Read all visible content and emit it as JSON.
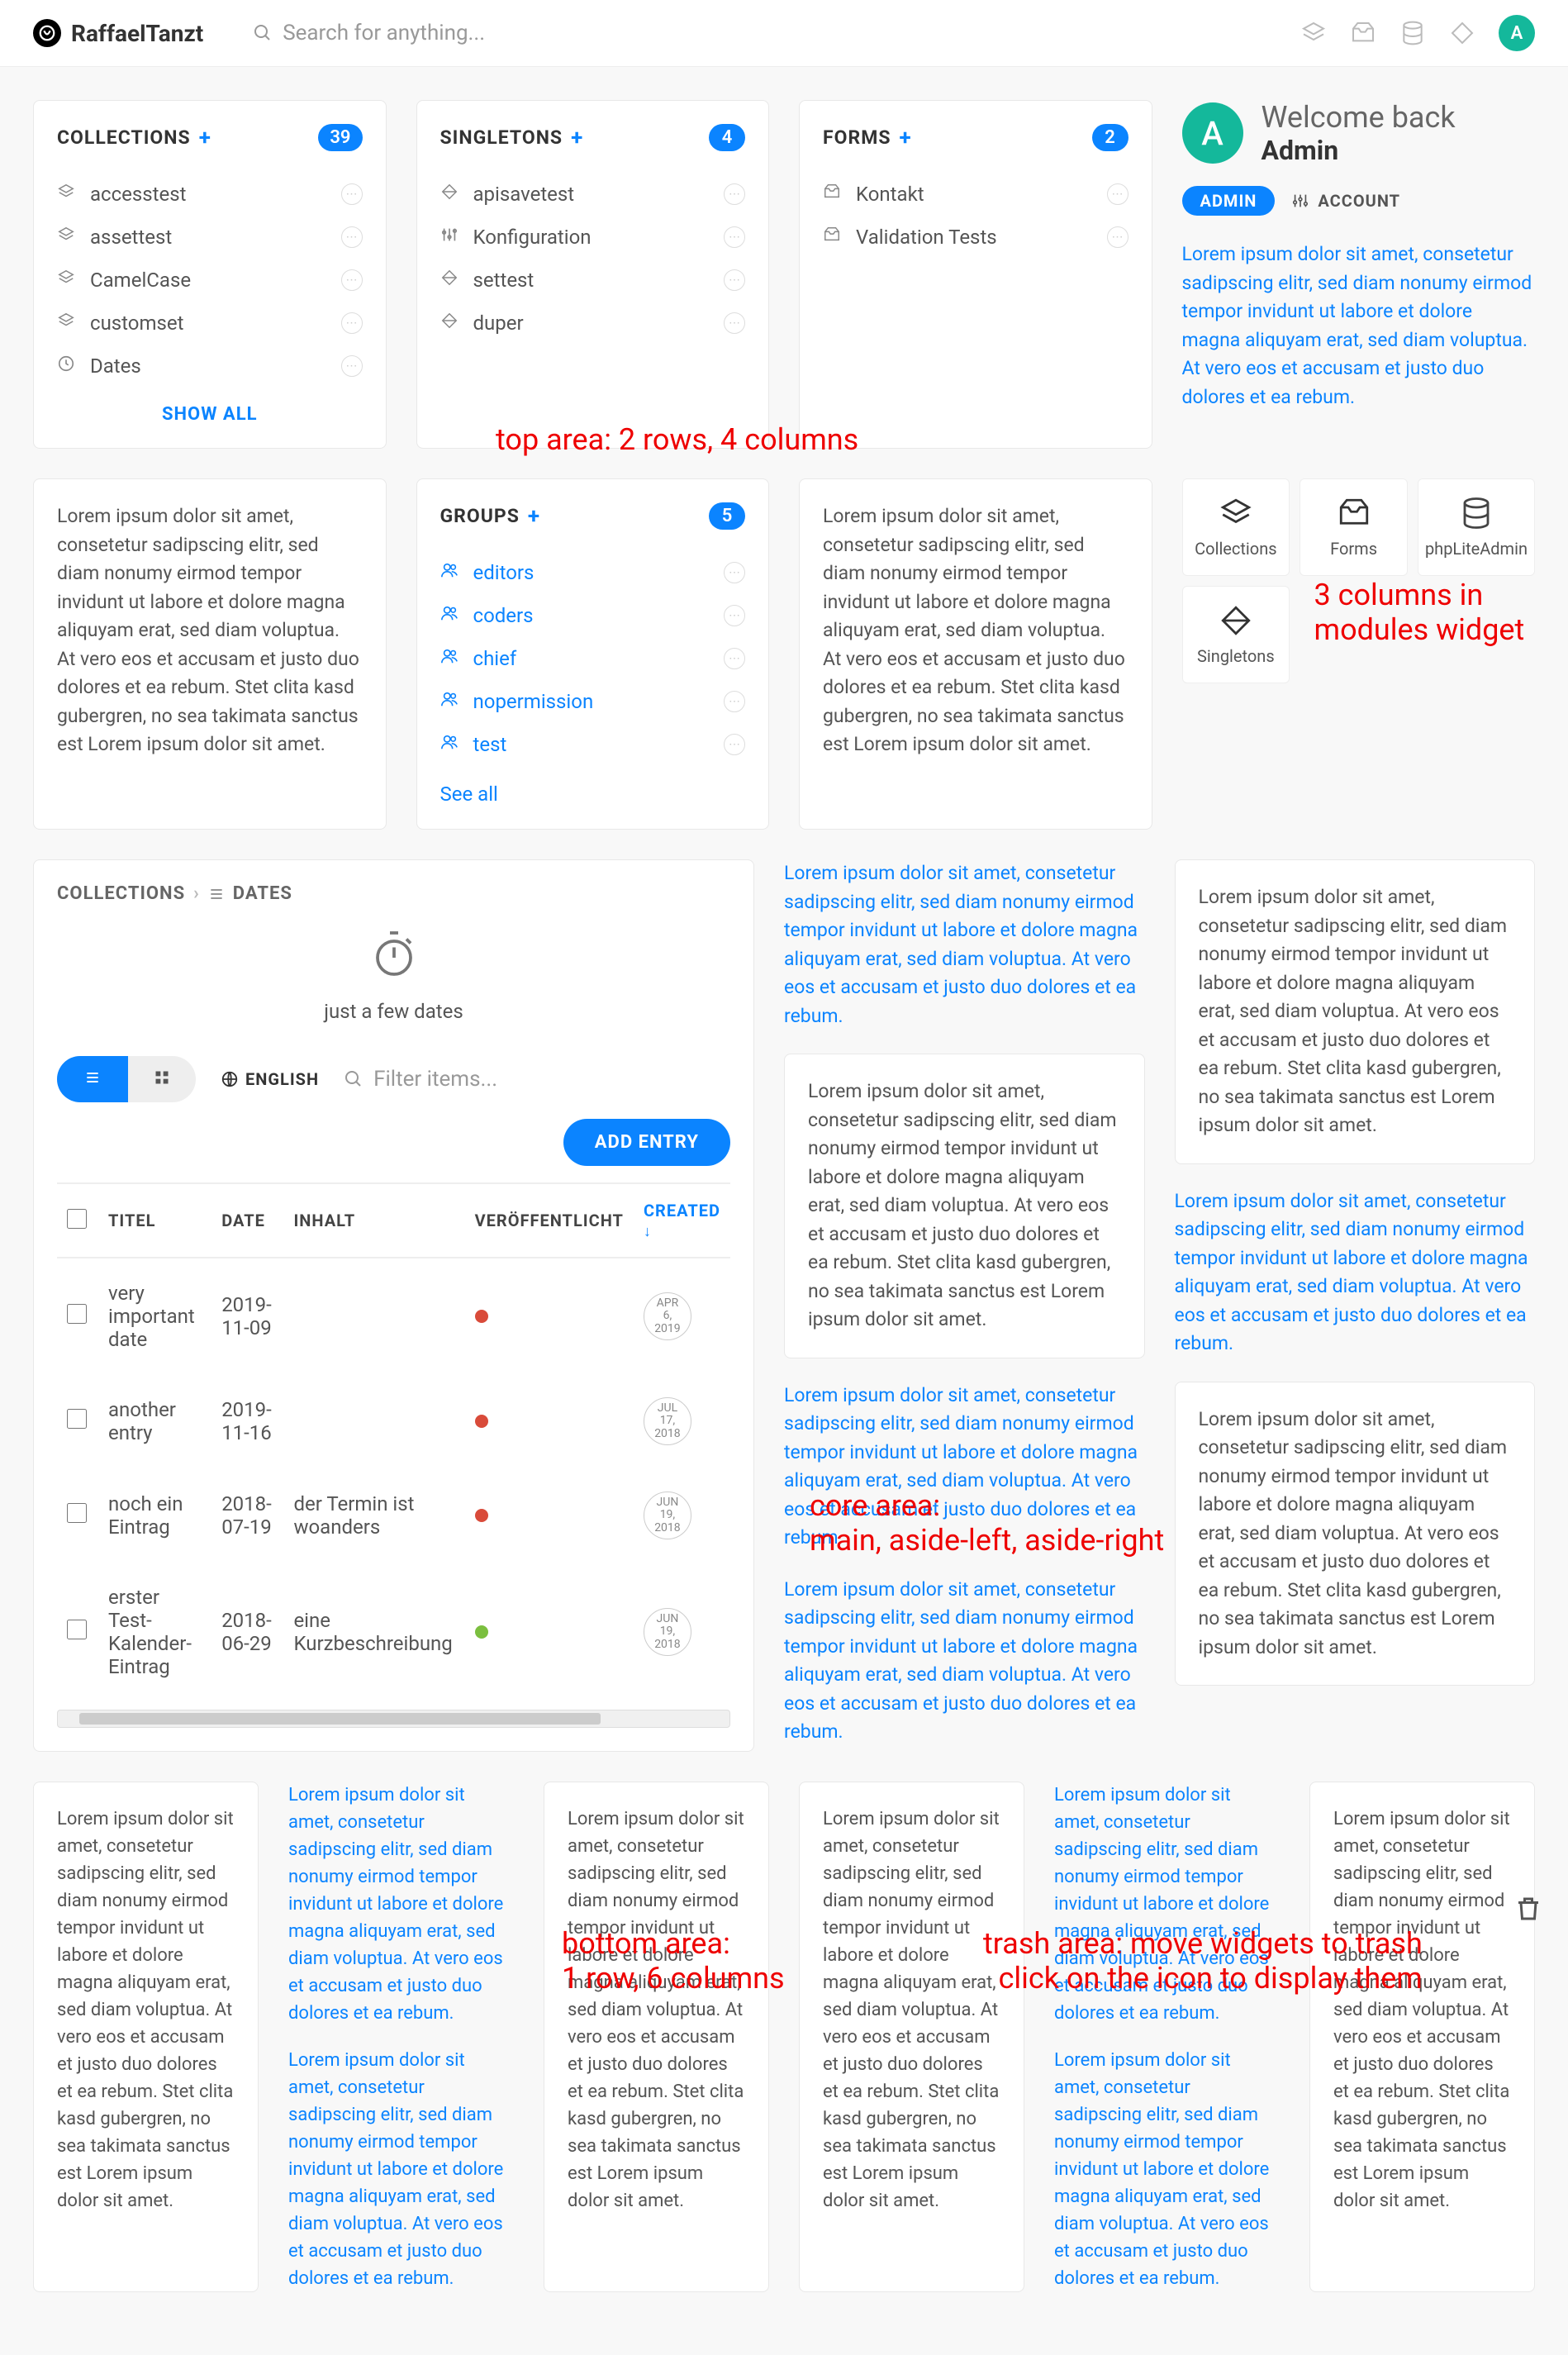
{
  "header": {
    "brand": "RaffaelTanzt",
    "search_placeholder": "Search for anything...",
    "avatar_letter": "A"
  },
  "top": {
    "collections": {
      "title": "COLLECTIONS",
      "count": "39",
      "items": [
        "accesstest",
        "assettest",
        "CamelCase",
        "customset",
        "Dates"
      ],
      "show_all": "SHOW ALL"
    },
    "singletons": {
      "title": "SINGLETONS",
      "count": "4",
      "items": [
        "apisavetest",
        "Konfiguration",
        "settest",
        "duper"
      ]
    },
    "forms": {
      "title": "FORMS",
      "count": "2",
      "items": [
        "Kontakt",
        "Validation Tests"
      ]
    },
    "welcome": {
      "line1": "Welcome back",
      "line2": "Admin",
      "pill": "ADMIN",
      "account": "ACCOUNT",
      "lorem": "Lorem ipsum dolor sit amet, consetetur sadipscing elitr, sed diam nonumy eirmod tempor invidunt ut labore et dolore magna aliquyam erat, sed diam voluptua. At vero eos et accusam et justo duo dolores et ea rebum."
    },
    "groups": {
      "title": "GROUPS",
      "count": "5",
      "items": [
        "editors",
        "coders",
        "chief",
        "nopermission",
        "test"
      ],
      "see_all": "See all"
    },
    "lorem_card1": "Lorem ipsum dolor sit amet, consetetur sadipscing elitr, sed diam nonumy eirmod tempor invidunt ut labore et dolore magna aliquyam erat, sed diam voluptua. At vero eos et accusam et justo duo dolores et ea rebum. Stet clita kasd gubergren, no sea takimata sanctus est Lorem ipsum dolor sit amet.",
    "lorem_card2": "Lorem ipsum dolor sit amet, consetetur sadipscing elitr, sed diam nonumy eirmod tempor invidunt ut labore et dolore magna aliquyam erat, sed diam voluptua. At vero eos et accusam et justo duo dolores et ea rebum. Stet clita kasd gubergren, no sea takimata sanctus est Lorem ipsum dolor sit amet.",
    "modules": [
      "Collections",
      "Forms",
      "phpLiteAdmin",
      "Singletons"
    ]
  },
  "annotations": {
    "top": "top area: 2 rows, 4 columns",
    "modules": "3 columns in modules widget",
    "core": "core area:\nmain, aside-left, aside-right",
    "bottom": "bottom area:\n1 row, 6 columns",
    "trash": "trash area: move widgets to trash\nclick on the icon to display them"
  },
  "core": {
    "breadcrumb": [
      "COLLECTIONS",
      "DATES"
    ],
    "subtitle": "just a few dates",
    "lang": "ENGLISH",
    "filter_placeholder": "Filter items...",
    "add_entry": "ADD ENTRY",
    "columns": [
      "TITEL",
      "DATE",
      "INHALT",
      "VERÖFFENTLICHT",
      "CREATED"
    ],
    "rows": [
      {
        "titel": "very important date",
        "date": "2019-11-09",
        "inhalt": "",
        "pub": "red",
        "created": [
          "APR",
          "6,",
          "2019"
        ]
      },
      {
        "titel": "another entry",
        "date": "2019-11-16",
        "inhalt": "",
        "pub": "red",
        "created": [
          "JUL",
          "17,",
          "2018"
        ]
      },
      {
        "titel": "noch ein Eintrag",
        "date": "2018-07-19",
        "inhalt": "der Termin ist woanders",
        "pub": "red",
        "created": [
          "JUN",
          "19,",
          "2018"
        ]
      },
      {
        "titel": "erster Test-Kalender-Eintrag",
        "date": "2018-06-29",
        "inhalt": "eine Kurzbeschreibung",
        "pub": "green",
        "created": [
          "JUN",
          "19,",
          "2018"
        ]
      }
    ],
    "aside_left": [
      {
        "blue": true,
        "text": "Lorem ipsum dolor sit amet, consetetur sadipscing elitr, sed diam nonumy eirmod tempor invidunt ut labore et dolore magna aliquyam erat, sed diam voluptua. At vero eos et accusam et justo duo dolores et ea rebum."
      },
      {
        "card": true,
        "text": "Lorem ipsum dolor sit amet, consetetur sadipscing elitr, sed diam nonumy eirmod tempor invidunt ut labore et dolore magna aliquyam erat, sed diam voluptua. At vero eos et accusam et justo duo dolores et ea rebum. Stet clita kasd gubergren, no sea takimata sanctus est Lorem ipsum dolor sit amet."
      },
      {
        "blue": true,
        "text": "Lorem ipsum dolor sit amet, consetetur sadipscing elitr, sed diam nonumy eirmod tempor invidunt ut labore et dolore magna aliquyam erat, sed diam voluptua. At vero eos et accusam et justo duo dolores et ea rebum."
      },
      {
        "blue": true,
        "text": "Lorem ipsum dolor sit amet, consetetur sadipscing elitr, sed diam nonumy eirmod tempor invidunt ut labore et dolore magna aliquyam erat, sed diam voluptua. At vero eos et accusam et justo duo dolores et ea rebum."
      }
    ],
    "aside_right": [
      {
        "card": true,
        "text": "Lorem ipsum dolor sit amet, consetetur sadipscing elitr, sed diam nonumy eirmod tempor invidunt ut labore et dolore magna aliquyam erat, sed diam voluptua. At vero eos et accusam et justo duo dolores et ea rebum. Stet clita kasd gubergren, no sea takimata sanctus est Lorem ipsum dolor sit amet."
      },
      {
        "blue": true,
        "text": "Lorem ipsum dolor sit amet, consetetur sadipscing elitr, sed diam nonumy eirmod tempor invidunt ut labore et dolore magna aliquyam erat, sed diam voluptua. At vero eos et accusam et justo duo dolores et ea rebum."
      },
      {
        "card": true,
        "text": "Lorem ipsum dolor sit amet, consetetur sadipscing elitr, sed diam nonumy eirmod tempor invidunt ut labore et dolore magna aliquyam erat, sed diam voluptua. At vero eos et accusam et justo duo dolores et ea rebum. Stet clita kasd gubergren, no sea takimata sanctus est Lorem ipsum dolor sit amet."
      }
    ]
  },
  "bottom": [
    {
      "card": true,
      "text": "Lorem ipsum dolor sit amet, consetetur sadipscing elitr, sed diam nonumy eirmod tempor invidunt ut labore et dolore magna aliquyam erat, sed diam voluptua. At vero eos et accusam et justo duo dolores et ea rebum. Stet clita kasd gubergren, no sea takimata sanctus est Lorem ipsum dolor sit amet."
    },
    {
      "blue": true,
      "text": "Lorem ipsum dolor sit amet, consetetur sadipscing elitr, sed diam nonumy eirmod tempor invidunt ut labore et dolore magna aliquyam erat, sed diam voluptua. At vero eos et accusam et justo duo dolores et ea rebum.",
      "text2": "Lorem ipsum dolor sit amet, consetetur sadipscing elitr, sed diam nonumy eirmod tempor invidunt ut labore et dolore magna aliquyam erat, sed diam voluptua. At vero eos et accusam et justo duo dolores et ea rebum."
    },
    {
      "card": true,
      "text": "Lorem ipsum dolor sit amet, consetetur sadipscing elitr, sed diam nonumy eirmod tempor invidunt ut labore et dolore magna aliquyam erat, sed diam voluptua. At vero eos et accusam et justo duo dolores et ea rebum. Stet clita kasd gubergren, no sea takimata sanctus est Lorem ipsum dolor sit amet."
    },
    {
      "card": true,
      "text": "Lorem ipsum dolor sit amet, consetetur sadipscing elitr, sed diam nonumy eirmod tempor invidunt ut labore et dolore magna aliquyam erat, sed diam voluptua. At vero eos et accusam et justo duo dolores et ea rebum. Stet clita kasd gubergren, no sea takimata sanctus est Lorem ipsum dolor sit amet."
    },
    {
      "blue": true,
      "text": "Lorem ipsum dolor sit amet, consetetur sadipscing elitr, sed diam nonumy eirmod tempor invidunt ut labore et dolore magna aliquyam erat, sed diam voluptua. At vero eos et accusam et justo duo dolores et ea rebum.",
      "text2": "Lorem ipsum dolor sit amet, consetetur sadipscing elitr, sed diam nonumy eirmod tempor invidunt ut labore et dolore magna aliquyam erat, sed diam voluptua. At vero eos et accusam et justo duo dolores et ea rebum."
    },
    {
      "card": true,
      "text": "Lorem ipsum dolor sit amet, consetetur sadipscing elitr, sed diam nonumy eirmod tempor invidunt ut labore et dolore magna aliquyam erat, sed diam voluptua. At vero eos et accusam et justo duo dolores et ea rebum. Stet clita kasd gubergren, no sea takimata sanctus est Lorem ipsum dolor sit amet."
    }
  ]
}
